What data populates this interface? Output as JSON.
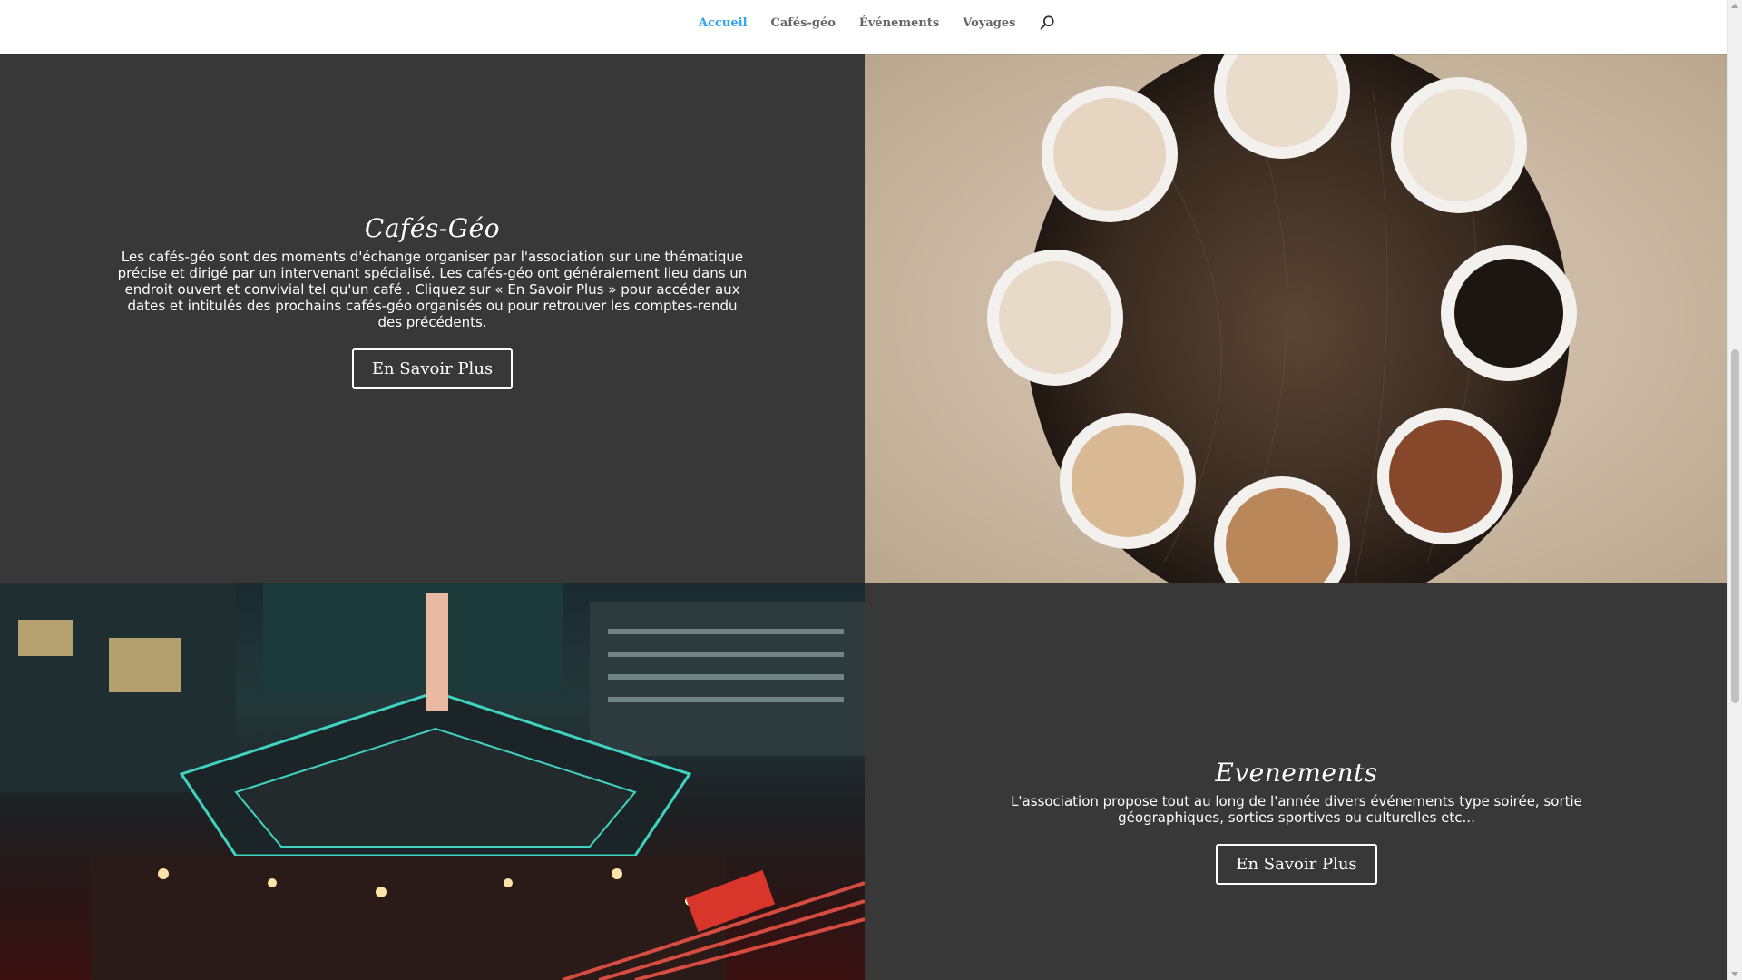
{
  "nav": {
    "items": [
      {
        "label": "Accueil",
        "active": true
      },
      {
        "label": "Cafés-géo",
        "active": false
      },
      {
        "label": "Événements",
        "active": false
      },
      {
        "label": "Voyages",
        "active": false
      }
    ],
    "search_icon": "search-icon"
  },
  "cafes": {
    "title": "Cafés-Géo",
    "text": "Les cafés-géo sont des moments d'échange organiser par l'association sur une thématique précise et dirigé par un intervenant spécialisé. Les cafés-géo ont généralement lieu dans un endroit ouvert et convivial tel qu'un café . Cliquez sur « En Savoir Plus » pour accéder aux dates et intitulés des prochains cafés-géo organisés ou pour retrouver les comptes-rendu des précédents.",
    "button": "En Savoir Plus"
  },
  "evenements": {
    "title": "Evenements",
    "text": "L'association propose tout au long de l'année divers événements type soirée, sortie géographiques, sorties sportives ou culturelles etc...",
    "button": "En Savoir Plus"
  },
  "colors": {
    "accent": "#2ea3f2",
    "dark_bg": "#383838",
    "nav_text": "#666666"
  }
}
